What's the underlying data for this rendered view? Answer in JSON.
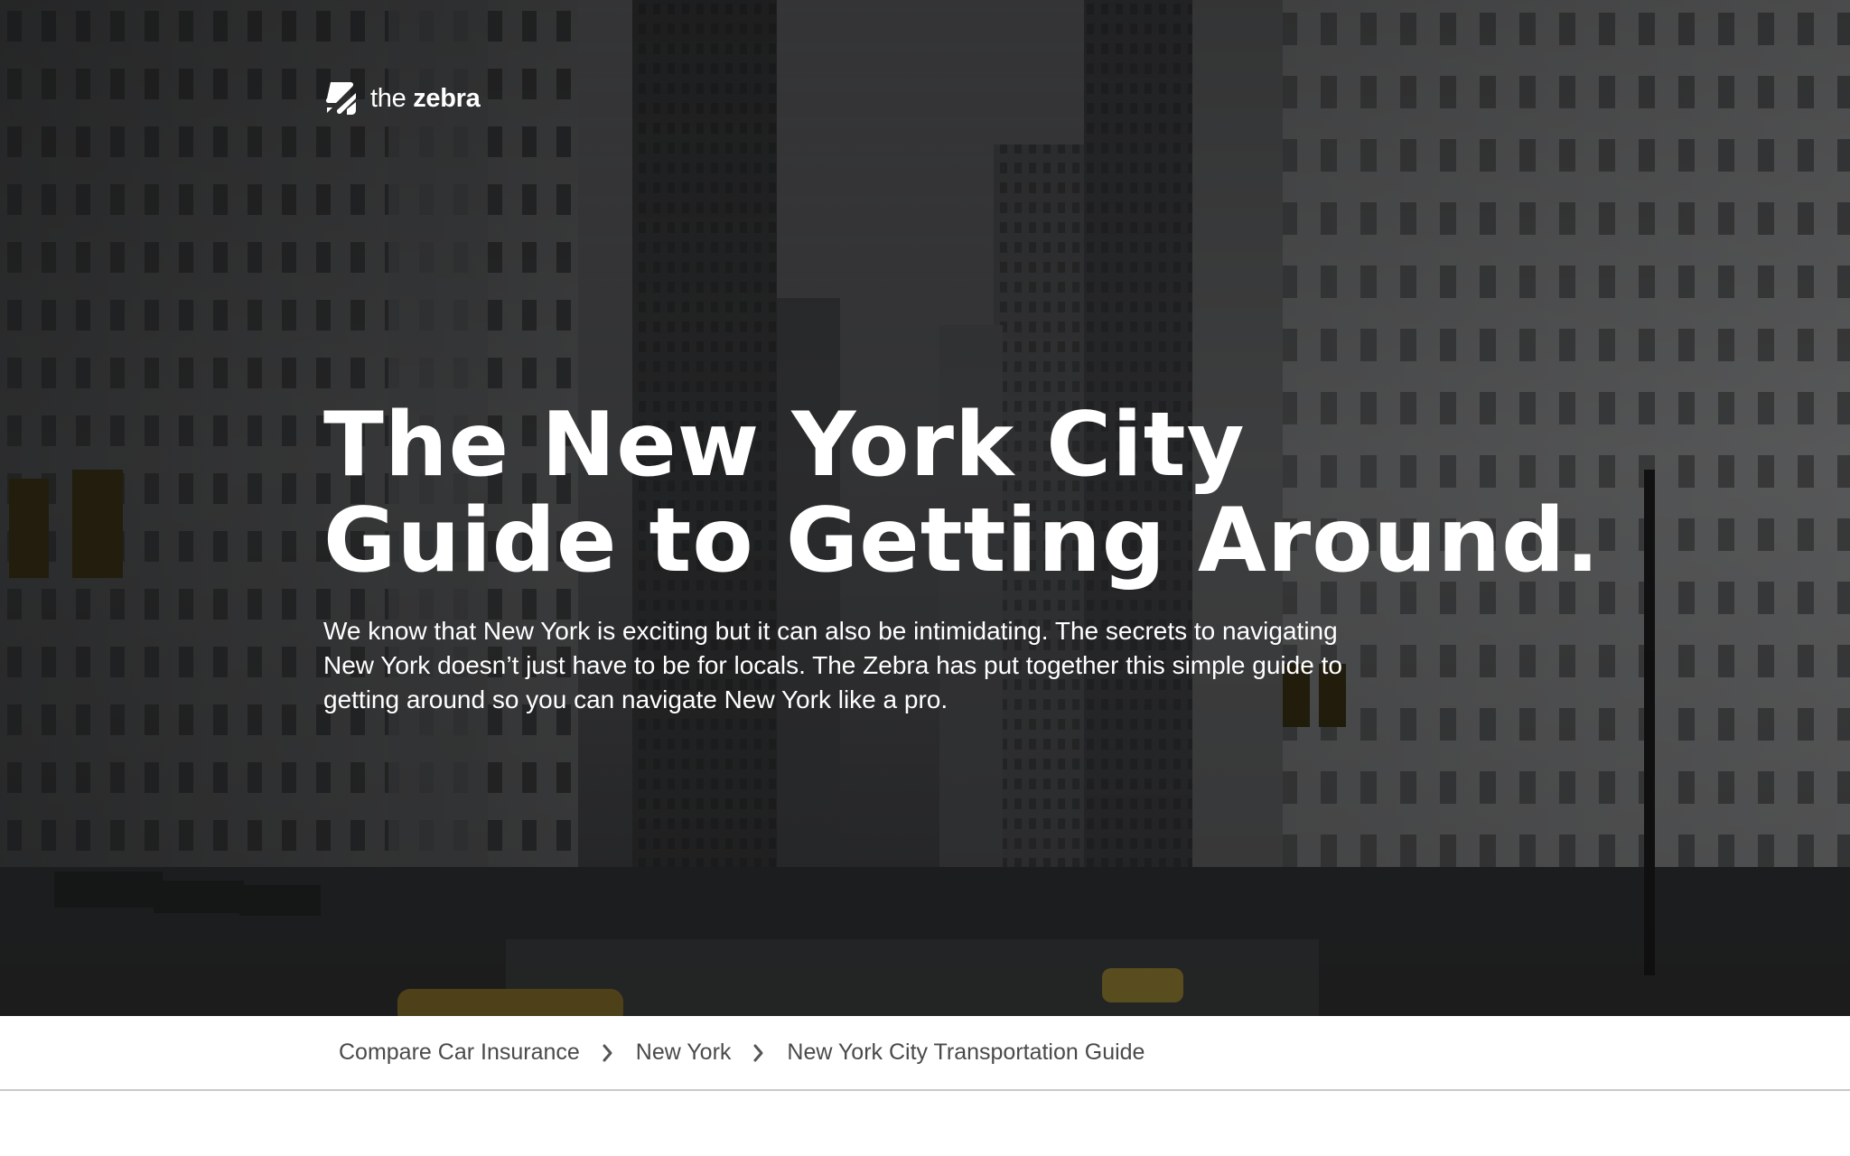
{
  "logo": {
    "light_text": "the",
    "bold_text": "zebra",
    "icon": "zebra-stripes-logo-icon"
  },
  "hero": {
    "title_line_1": "The New York City",
    "title_line_2": "Guide to Getting Around.",
    "lead": "We know that New York is exciting but it can also be intimidating. The secrets to navigating New York doesn’t just have to be for locals. The Zebra has put together this simple guide to getting around so you can navigate New York like a pro.",
    "background": "dimmed photo of a Manhattan avenue lined with tall buildings"
  },
  "breadcrumb": {
    "items": [
      {
        "label": "Compare Car Insurance"
      },
      {
        "label": "New York"
      },
      {
        "label": "New York City Transportation Guide"
      }
    ],
    "separator_icon": "chevron-right-icon"
  },
  "colors": {
    "hero_text": "#ffffff",
    "breadcrumb_text": "#4a4a4a",
    "breadcrumb_border": "#c9c9c9",
    "hero_base": "#2b2c2e"
  }
}
